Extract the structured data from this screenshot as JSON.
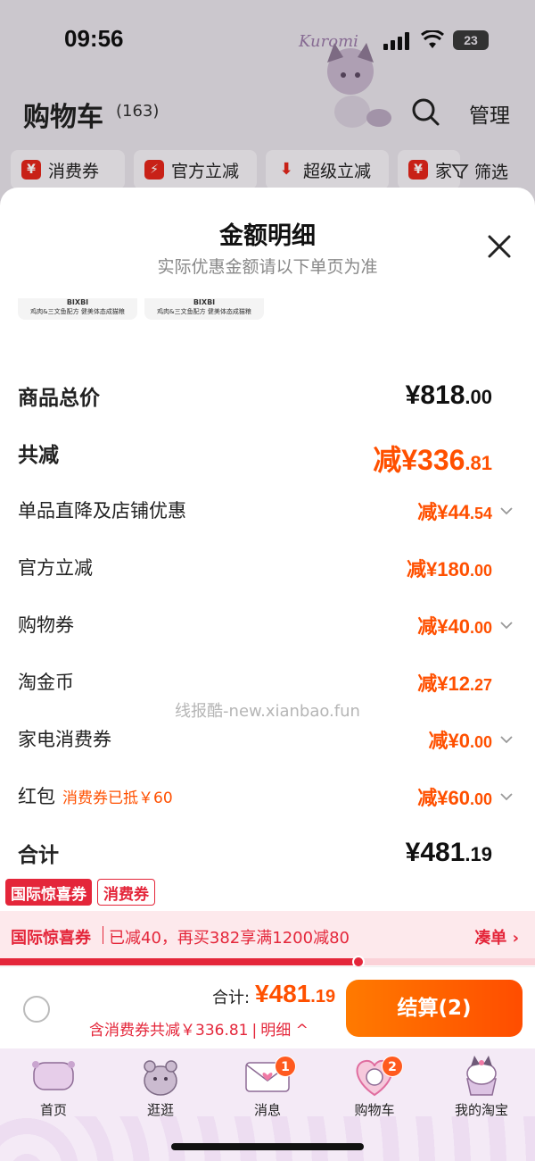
{
  "status_bar": {
    "time": "09:56",
    "battery": "23",
    "decor_text": "Kuromi"
  },
  "header": {
    "title": "购物车",
    "count": "(163)",
    "manage": "管理"
  },
  "filters": {
    "chips": [
      "消费券",
      "官方立减",
      "超级立减",
      "家"
    ],
    "chip_icons": [
      "¥",
      "⚡",
      "⬇",
      "¥"
    ],
    "filter_label": "筛选"
  },
  "sheet": {
    "title": "金额明细",
    "subtitle": "实际优惠金额请以下单页为准",
    "thumbs": [
      {
        "brand": "BIXBI",
        "desc": "鸡肉&三文鱼配方 健美体态成猫粮"
      },
      {
        "brand": "BIXBI",
        "desc": "鸡肉&三文鱼配方 健美体态成猫粮"
      }
    ],
    "rows": [
      {
        "label": "商品总价",
        "note": "",
        "prefix": "¥",
        "int": "818",
        "dec": ".00"
      },
      {
        "label": "共减",
        "note": "",
        "prefix": "减¥",
        "int": "336",
        "dec": ".81"
      },
      {
        "label": "单品直降及店铺优惠",
        "note": "",
        "prefix": "减¥",
        "int": "44",
        "dec": ".54"
      },
      {
        "label": "官方立减",
        "note": "",
        "prefix": "减¥",
        "int": "180",
        "dec": ".00"
      },
      {
        "label": "购物券",
        "note": "",
        "prefix": "减¥",
        "int": "40",
        "dec": ".00"
      },
      {
        "label": "淘金币",
        "note": "",
        "prefix": "减¥",
        "int": "12",
        "dec": ".27"
      },
      {
        "label": "家电消费券",
        "note": "",
        "prefix": "减¥",
        "int": "0",
        "dec": ".00"
      },
      {
        "label": "红包",
        "note": "消费券已抵￥60",
        "prefix": "减¥",
        "int": "60",
        "dec": ".00"
      },
      {
        "label": "合计",
        "note": "",
        "prefix": "¥",
        "int": "481",
        "dec": ".19"
      }
    ],
    "watermark": "线报酷-new.xianbao.fun"
  },
  "promo": {
    "tag_main": "国际惊喜券",
    "tag_coupon": "消费券",
    "bar_title": "国际惊喜券",
    "bar_text": "已减40，再买382享满1200减80",
    "bar_link": "凑单 ›",
    "progress": 0.67
  },
  "checkout": {
    "total_label": "合计:",
    "total_int": "¥481",
    "total_dec": ".19",
    "sub_text": "含消费券共减￥336.81",
    "sub_sep": "|",
    "detail": "明细 ^",
    "button": "结算(2)"
  },
  "tabbar": {
    "tabs": [
      {
        "label": "首页",
        "badge": ""
      },
      {
        "label": "逛逛",
        "badge": ""
      },
      {
        "label": "消息",
        "badge": "1"
      },
      {
        "label": "购物车",
        "badge": "2"
      },
      {
        "label": "我的淘宝",
        "badge": ""
      }
    ]
  },
  "colors": {
    "accent": "#ff5000",
    "promo_red": "#e4263a",
    "tabbar_bg": "#f4eaf6"
  }
}
